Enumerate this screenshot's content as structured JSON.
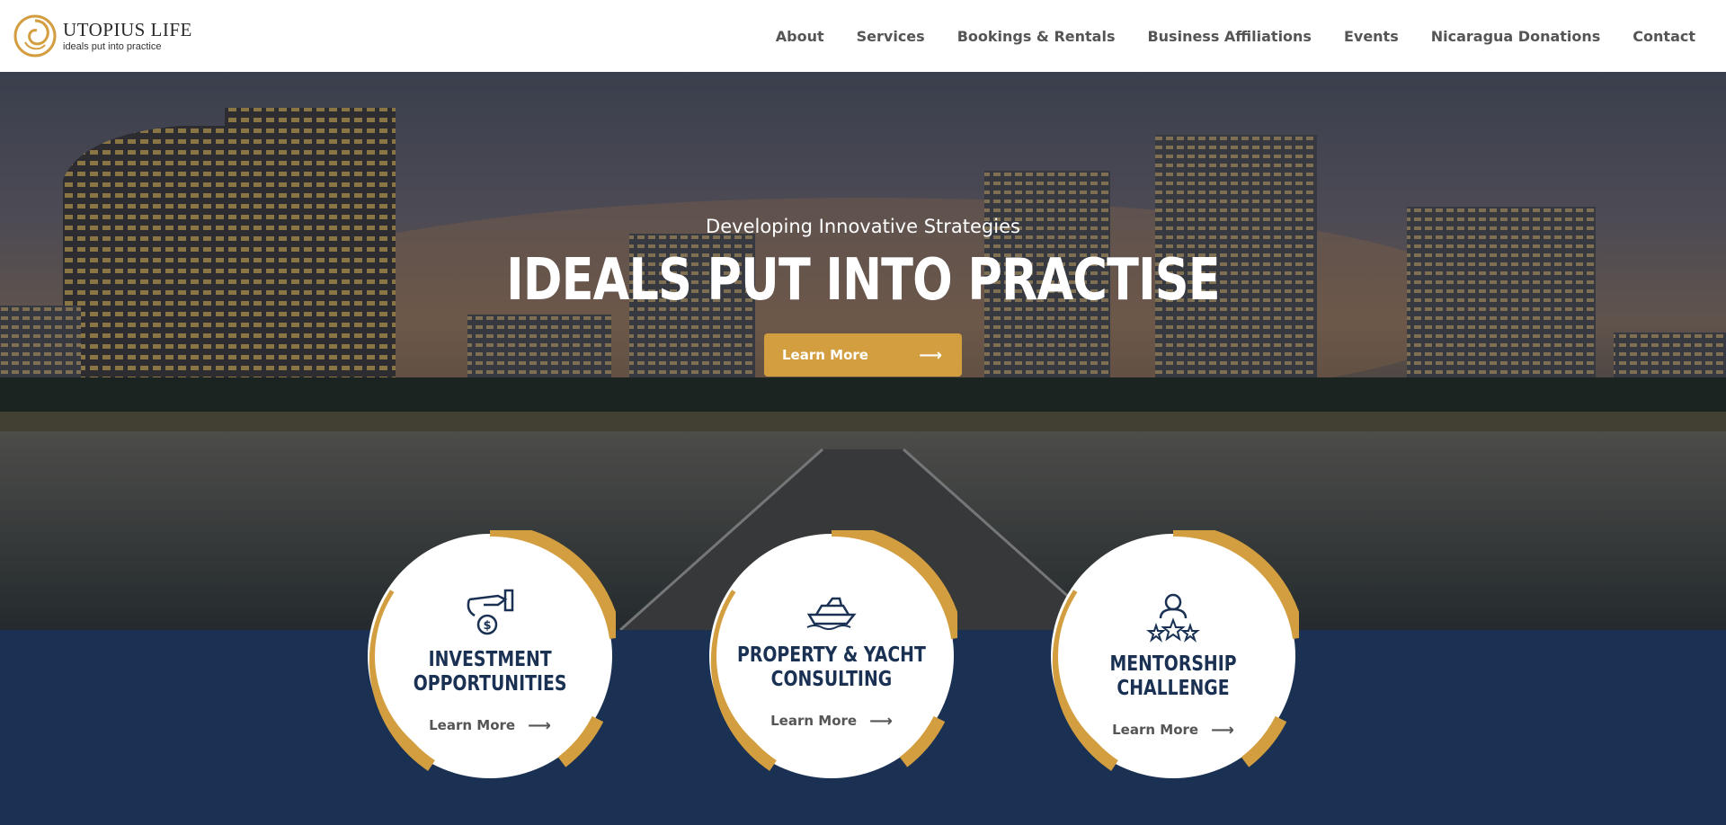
{
  "brand": {
    "name": "UTOPIUS LIFE",
    "tagline": "ideals put into practice",
    "accent_color": "#d39e3f",
    "navy_color": "#1a3153"
  },
  "nav": {
    "items": [
      {
        "label": "About"
      },
      {
        "label": "Services"
      },
      {
        "label": "Bookings & Rentals"
      },
      {
        "label": "Business Affiliations"
      },
      {
        "label": "Events"
      },
      {
        "label": "Nicaragua Donations"
      },
      {
        "label": "Contact"
      }
    ]
  },
  "hero": {
    "subtitle": "Developing Innovative Strategies",
    "title": "IDEALS PUT INTO PRACTISE",
    "button_label": "Learn More",
    "button_icon": "arrow-right-icon"
  },
  "services": [
    {
      "icon": "investment-hand-coin-icon",
      "title_line1": "INVESTMENT",
      "title_line2": "OPPORTUNITIES",
      "link_label": "Learn More"
    },
    {
      "icon": "yacht-icon",
      "title_line1": "PROPERTY & YACHT",
      "title_line2": "CONSULTING",
      "link_label": "Learn More"
    },
    {
      "icon": "mentorship-stars-icon",
      "title_line1": "MENTORSHIP",
      "title_line2": "CHALLENGE",
      "link_label": "Learn More"
    }
  ]
}
